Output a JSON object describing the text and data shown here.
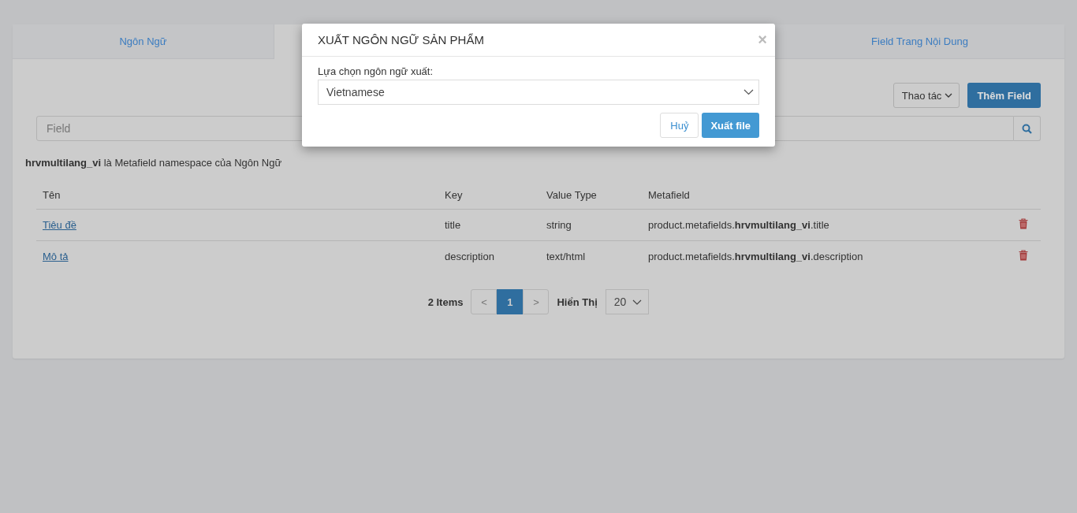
{
  "tabs": [
    {
      "label": "Ngôn Ngữ",
      "selected": false
    },
    {
      "selected": true
    },
    {
      "label": "Field Trang Nội Dung",
      "selected": false
    }
  ],
  "toolbar": {
    "actions_dropdown": "Thao tác",
    "add_button": "Thêm Field"
  },
  "search": {
    "placeholder": "Field"
  },
  "namespace_note": "**hrvmultilang_vi** là Metafield namespace của Ngôn Ngữ",
  "table": {
    "columns": [
      "Tên",
      "Key",
      "Value Type",
      "Metafield"
    ],
    "rows": [
      {
        "name": "Tiêu đề",
        "key": "title",
        "value_type": "string",
        "metafield": "product.metafields.**hrvmultilang_vi**.title"
      },
      {
        "name": "Mô tả",
        "key": "description",
        "value_type": "text/html",
        "metafield": "product.metafields.**hrvmultilang_vi**.description"
      }
    ]
  },
  "pagination": {
    "count": "2 Items",
    "prev": "<",
    "pages": [
      {
        "label": "1",
        "selected": true
      }
    ],
    "next": ">",
    "page_size_label": "Hiển Thị",
    "page_size": "20"
  },
  "modal": {
    "title": "XUẤT NGÔN NGỮ SẢN PHẨM",
    "close": "×",
    "field_label": "Lựa chọn ngôn ngữ xuất:",
    "language": "Vietnamese",
    "cancel": "Huỷ",
    "submit": "Xuất file"
  }
}
